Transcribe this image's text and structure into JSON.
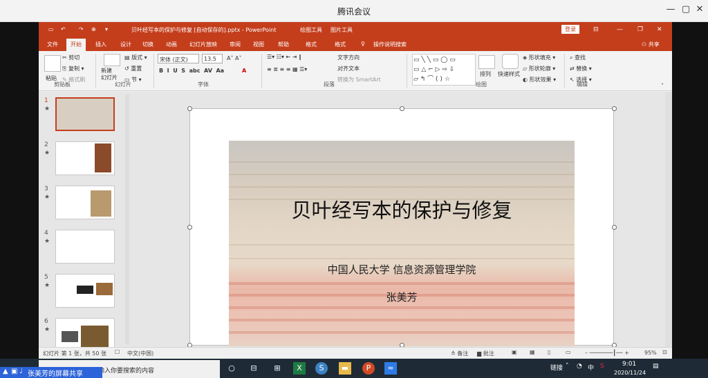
{
  "meeting": {
    "title": "腾讯会议",
    "controls": [
      "—",
      "▢",
      "✕"
    ],
    "share_label": "张美芳的屏幕共享"
  },
  "ppt": {
    "qat": [
      "▭",
      "↶",
      "↷",
      "⊕",
      "▾"
    ],
    "doc_title": "贝叶经写本的保护与修复 [自动保存的].pptx  -  PowerPoint",
    "context_tools": [
      "绘图工具",
      "图片工具"
    ],
    "login_button": "登录",
    "tabs": [
      "文件",
      "开始",
      "插入",
      "设计",
      "切换",
      "动画",
      "幻灯片放映",
      "审阅",
      "视图",
      "帮助",
      "格式",
      "格式"
    ],
    "active_tab": "开始",
    "tell_me": "操作说明搜索",
    "share": "共享",
    "ribbon": {
      "paste": "粘贴",
      "cut": "剪切",
      "copy": "复制",
      "format_painter": "格式刷",
      "clipboard": "剪贴板",
      "new_slide": "新建\n幻灯片",
      "layout": "版式",
      "reset": "重置",
      "section": "节",
      "slides": "幻灯片",
      "font_name": "宋体 (正文)",
      "font_size": "13.5",
      "font": "字体",
      "text_direction": "文字方向",
      "align_text": "对齐文本",
      "smartart": "转换为 SmartArt",
      "paragraph": "段落",
      "arrange": "排列",
      "quick_styles": "快速样式",
      "shape_fill": "形状填充",
      "shape_outline": "形状轮廓",
      "shape_effects": "形状效果",
      "drawing": "绘图",
      "find": "查找",
      "replace": "替换",
      "select": "选择",
      "editing": "编辑"
    },
    "thumbnails": [
      {
        "num": "1",
        "star": "★"
      },
      {
        "num": "2",
        "star": "★"
      },
      {
        "num": "3",
        "star": "★"
      },
      {
        "num": "4",
        "star": "★"
      },
      {
        "num": "5",
        "star": "★"
      },
      {
        "num": "6",
        "star": "★"
      }
    ],
    "slide": {
      "title": "贝叶经写本的保护与修复",
      "subtitle": "中国人民大学  信息资源管理学院",
      "author": "张美芳"
    },
    "status": {
      "slide_info": "幻灯片 第 1 张，共 50 张",
      "language": "中文(中国)",
      "notes": "备注",
      "comments": "批注",
      "zoom": "95%"
    }
  },
  "taskbar": {
    "search_placeholder": "输入你要搜索的内容",
    "tray_link": "链接",
    "ime": "中",
    "time": "9:01",
    "date": "2020/11/24"
  }
}
